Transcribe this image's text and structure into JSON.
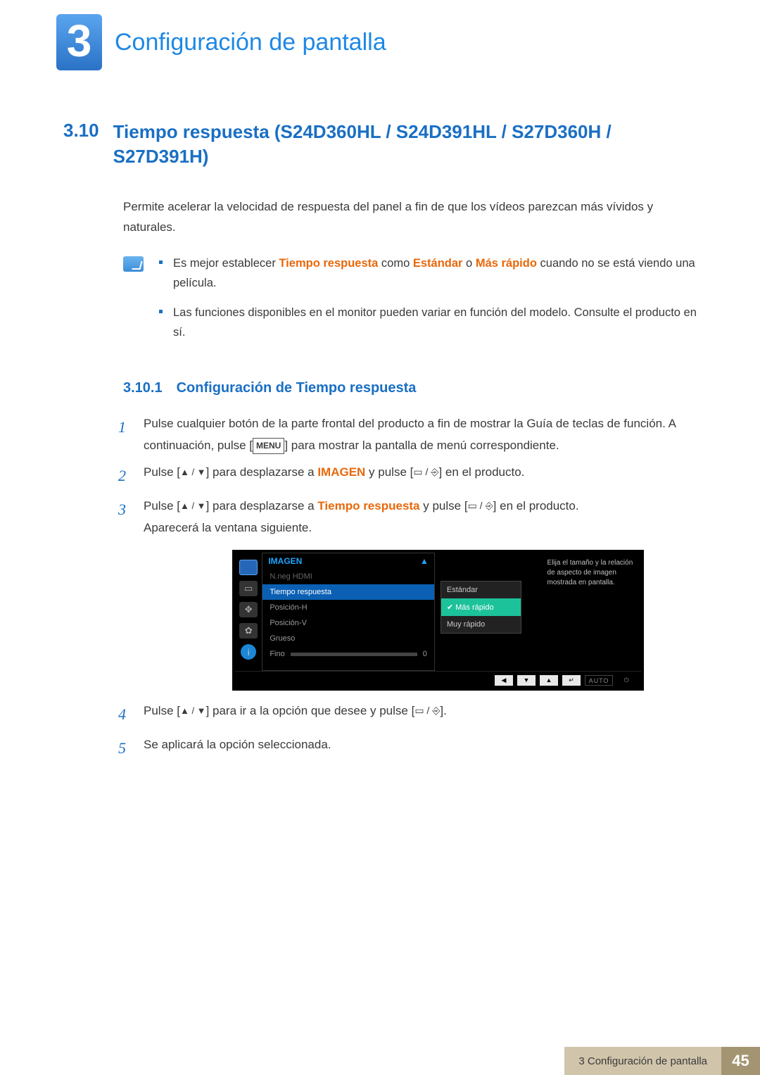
{
  "chapter": {
    "number": "3",
    "title": "Configuración de pantalla"
  },
  "section": {
    "number": "3.10",
    "title": "Tiempo respuesta (S24D360HL / S24D391HL / S27D360H / S27D391H)"
  },
  "intro": "Permite acelerar la velocidad de respuesta del panel a fin de que los vídeos parezcan más vívidos y naturales.",
  "notes": {
    "n1_pre": "Es mejor establecer ",
    "n1_b1": "Tiempo respuesta",
    "n1_mid1": " como ",
    "n1_b2": "Estándar",
    "n1_mid2": " o ",
    "n1_b3": "Más rápido",
    "n1_post": " cuando no se está viendo una película.",
    "n2": "Las funciones disponibles en el monitor pueden variar en función del modelo. Consulte el producto en sí."
  },
  "subsection": {
    "number": "3.10.1",
    "title": "Configuración de Tiempo respuesta"
  },
  "steps": {
    "s1a": "Pulse cualquier botón de la parte frontal del producto a fin de mostrar la Guía de teclas de función. A continuación, pulse [",
    "menu_key": "MENU",
    "s1b": "] para mostrar la pantalla de menú correspondiente.",
    "s2a": "Pulse [",
    "updown": "▲ / ▼",
    "s2b": "] para desplazarse a ",
    "imagen": "IMAGEN",
    "s2c": " y pulse [",
    "src": "▭ / ⎆",
    "s2d": "] en el producto.",
    "s3a": "Pulse [",
    "s3b": "] para desplazarse a ",
    "tiempo": "Tiempo respuesta",
    "s3c": " y pulse [",
    "s3d": "] en el producto.",
    "s3e": "Aparecerá la ventana siguiente.",
    "s4a": "Pulse [",
    "s4b": "] para ir a la opción que desee y pulse [",
    "s4c": "].",
    "s5": "Se aplicará la opción seleccionada."
  },
  "osd": {
    "header": "IMAGEN",
    "up": "▲",
    "items": {
      "hdmi": "N.neg HDMI",
      "tiempo": "Tiempo respuesta",
      "posh": "Posición-H",
      "posv": "Posición-V",
      "grueso": "Grueso",
      "fino": "Fino",
      "fino_val": "0"
    },
    "dropdown": {
      "opt1": "Estándar",
      "opt2": "Más rápido",
      "opt3": "Muy rápido",
      "check": "✔"
    },
    "help": "Elija el tamaño y la relación de aspecto de imagen mostrada en pantalla.",
    "footer": {
      "left": "◀",
      "down": "▼",
      "up": "▲",
      "enter": "↵",
      "auto": "AUTO",
      "power": "⏻"
    }
  },
  "footer": {
    "text": "3 Configuración de pantalla",
    "page": "45"
  }
}
